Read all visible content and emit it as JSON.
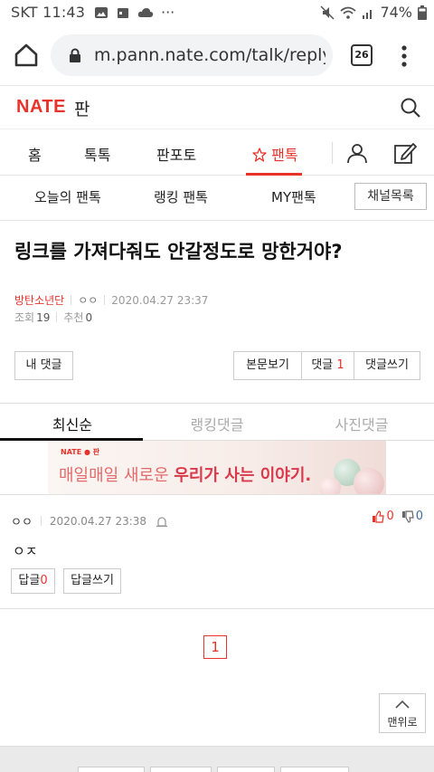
{
  "status_bar": {
    "carrier_time": "SKT 11:43",
    "ellipsis": "···",
    "battery": "74%"
  },
  "browser": {
    "url": "m.pann.nate.com/talk/reply/vi",
    "tab_count": "26"
  },
  "site": {
    "logo": "NATE",
    "logo_sub": "판"
  },
  "main_nav": [
    {
      "label": "홈"
    },
    {
      "label": "톡톡"
    },
    {
      "label": "판포토"
    },
    {
      "label": "팬톡"
    }
  ],
  "sub_nav": {
    "items": [
      {
        "label": "오늘의 팬톡"
      },
      {
        "label": "랭킹 팬톡"
      },
      {
        "label": "MY팬톡"
      }
    ],
    "channel_button": "채널목록"
  },
  "post": {
    "title": "링크를 가져다줘도 안갈정도로 망한거야?",
    "author": "방탄소년단",
    "nickname": "ㅇㅇ",
    "datetime": "2020.04.27 23:37",
    "views_label": "조회",
    "views": "19",
    "recommend_label": "추천",
    "recommend": "0"
  },
  "actions": {
    "my_comments": "내 댓글",
    "view_post": "본문보기",
    "comments_label": "댓글",
    "comments_count": "1",
    "write_comment": "댓글쓰기"
  },
  "comment_tabs": [
    {
      "label": "최신순"
    },
    {
      "label": "랭킹댓글"
    },
    {
      "label": "사진댓글"
    }
  ],
  "banner": {
    "logo": "NATE ● 판",
    "text_plain": "매일매일 새로운 ",
    "text_bold": "우리가 사는 이야기."
  },
  "comment": {
    "nickname": "ㅇㅇ",
    "datetime": "2020.04.27 23:38",
    "likes": "0",
    "dislikes": "0",
    "body": "ㅇㅈ",
    "reply_label": "답글",
    "reply_count": "0",
    "write_reply": "답글쓰기"
  },
  "pagination": {
    "current": "1"
  },
  "to_top": "맨위로",
  "colors": {
    "brand_red": "#e8332b",
    "text_gray": "#999999",
    "border": "#cccccc"
  }
}
